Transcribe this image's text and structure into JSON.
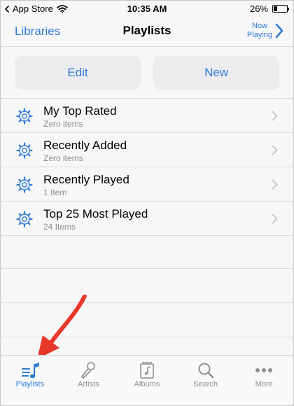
{
  "status_bar": {
    "carrier": "App Store",
    "time": "10:35 AM",
    "battery": "26%",
    "battery_level": 0.26
  },
  "nav": {
    "back_label": "Libraries",
    "title": "Playlists",
    "now_playing_line1": "Now",
    "now_playing_line2": "Playing"
  },
  "actions": {
    "edit_label": "Edit",
    "new_label": "New"
  },
  "playlists": [
    {
      "name": "My Top Rated",
      "count": "Zero items"
    },
    {
      "name": "Recently Added",
      "count": "Zero items"
    },
    {
      "name": "Recently Played",
      "count": "1 Item"
    },
    {
      "name": "Top 25 Most Played",
      "count": "24 Items"
    }
  ],
  "tabs": [
    {
      "label": "Playlists",
      "icon": "playlists-icon",
      "active": true
    },
    {
      "label": "Artists",
      "icon": "microphone-icon",
      "active": false
    },
    {
      "label": "Albums",
      "icon": "album-icon",
      "active": false
    },
    {
      "label": "Search",
      "icon": "search-icon",
      "active": false
    },
    {
      "label": "More",
      "icon": "more-icon",
      "active": false
    }
  ],
  "colors": {
    "accent": "#2f7ad8",
    "arrow": "#e8382a",
    "inactive": "#8e8e93"
  }
}
